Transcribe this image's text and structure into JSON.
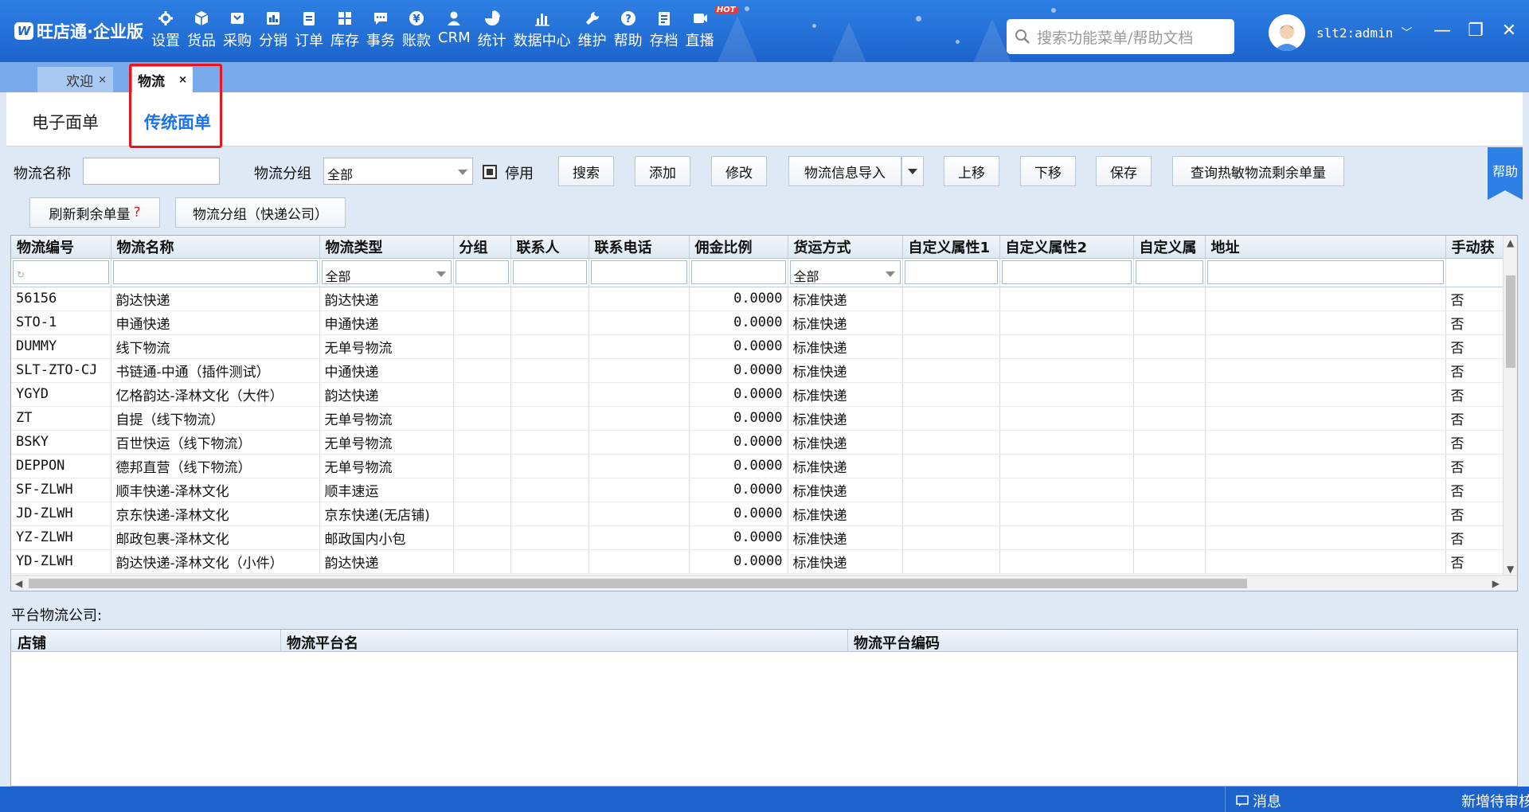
{
  "app": {
    "logo": "旺店通·企业版",
    "logo_mark": "W",
    "nav": [
      {
        "label": "设置",
        "icon": "gear-icon"
      },
      {
        "label": "货品",
        "icon": "cube-icon"
      },
      {
        "label": "采购",
        "icon": "cart-icon"
      },
      {
        "label": "分销",
        "icon": "grid-icon"
      },
      {
        "label": "订单",
        "icon": "clipboard-icon"
      },
      {
        "label": "库存",
        "icon": "blocks-icon"
      },
      {
        "label": "事务",
        "icon": "chat-icon"
      },
      {
        "label": "账款",
        "icon": "yen-icon"
      },
      {
        "label": "CRM",
        "icon": "person-icon"
      },
      {
        "label": "统计",
        "icon": "pie-icon"
      },
      {
        "label": "数据中心",
        "icon": "bar-chart-icon"
      },
      {
        "label": "维护",
        "icon": "wrench-icon"
      },
      {
        "label": "帮助",
        "icon": "question-icon"
      },
      {
        "label": "存档",
        "icon": "archive-icon"
      },
      {
        "label": "直播",
        "icon": "live-icon",
        "badge": "HOT"
      }
    ],
    "search_placeholder": "搜索功能菜单/帮助文档",
    "user": "slt2:admin",
    "window": {
      "minimize": "—",
      "restore": "❐",
      "close": "✕"
    }
  },
  "tabs": [
    {
      "label": "欢迎",
      "close": "×"
    },
    {
      "label": "物流",
      "close": "×",
      "active": true
    }
  ],
  "subtabs": {
    "electronic": "电子面单",
    "traditional": "传统面单"
  },
  "toolbar": {
    "name_label": "物流名称",
    "name_value": "",
    "group_label": "物流分组",
    "group_value": "全部",
    "disabled_label": "停用",
    "search": "搜索",
    "add": "添加",
    "modify": "修改",
    "import": "物流信息导入",
    "move_up": "上移",
    "move_down": "下移",
    "save": "保存",
    "query_thermal": "查询热敏物流剩余单量",
    "refresh_remaining": "刷新剩余单量",
    "refresh_q": "?",
    "group_courier": "物流分组（快递公司）",
    "help": "帮助"
  },
  "grid": {
    "columns": [
      "物流编号",
      "物流名称",
      "物流类型",
      "分组",
      "联系人",
      "联系电话",
      "佣金比例",
      "货运方式",
      "自定义属性1",
      "自定义属性2",
      "自定义属",
      "地址",
      "手动获"
    ],
    "filter": {
      "type": "全部",
      "shipping": "全部"
    },
    "rows": [
      [
        "56156",
        "韵达快递",
        "韵达快递",
        "",
        "",
        "",
        "0.0000",
        "标准快递",
        "",
        "",
        "",
        "",
        "否"
      ],
      [
        "STO-1",
        "申通快递",
        "申通快递",
        "",
        "",
        "",
        "0.0000",
        "标准快递",
        "",
        "",
        "",
        "",
        "否"
      ],
      [
        "DUMMY",
        "线下物流",
        "无单号物流",
        "",
        "",
        "",
        "0.0000",
        "标准快递",
        "",
        "",
        "",
        "",
        "否"
      ],
      [
        "SLT-ZTO-CJ",
        "书链通-中通（插件测试）",
        "中通快递",
        "",
        "",
        "",
        "0.0000",
        "标准快递",
        "",
        "",
        "",
        "",
        "否"
      ],
      [
        "YGYD",
        "亿格韵达-泽林文化（大件）",
        "韵达快递",
        "",
        "",
        "",
        "0.0000",
        "标准快递",
        "",
        "",
        "",
        "",
        "否"
      ],
      [
        "ZT",
        "自提（线下物流）",
        "无单号物流",
        "",
        "",
        "",
        "0.0000",
        "标准快递",
        "",
        "",
        "",
        "",
        "否"
      ],
      [
        "BSKY",
        "百世快运（线下物流）",
        "无单号物流",
        "",
        "",
        "",
        "0.0000",
        "标准快递",
        "",
        "",
        "",
        "",
        "否"
      ],
      [
        "DEPPON",
        "德邦直营（线下物流）",
        "无单号物流",
        "",
        "",
        "",
        "0.0000",
        "标准快递",
        "",
        "",
        "",
        "",
        "否"
      ],
      [
        "SF-ZLWH",
        "顺丰快递-泽林文化",
        "顺丰速运",
        "",
        "",
        "",
        "0.0000",
        "标准快递",
        "",
        "",
        "",
        "",
        "否"
      ],
      [
        "JD-ZLWH",
        "京东快递-泽林文化",
        "京东快递(无店铺)",
        "",
        "",
        "",
        "0.0000",
        "标准快递",
        "",
        "",
        "",
        "",
        "否"
      ],
      [
        "YZ-ZLWH",
        "邮政包裹-泽林文化",
        "邮政国内小包",
        "",
        "",
        "",
        "0.0000",
        "标准快递",
        "",
        "",
        "",
        "",
        "否"
      ],
      [
        "YD-ZLWH",
        "韵达快递-泽林文化（小件）",
        "韵达快递",
        "",
        "",
        "",
        "0.0000",
        "标准快递",
        "",
        "",
        "",
        "",
        "否"
      ]
    ]
  },
  "platform": {
    "label": "平台物流公司:",
    "columns": [
      "店铺",
      "物流平台名",
      "物流平台编码"
    ]
  },
  "statusbar": {
    "message": "消息",
    "new_pending": "新增待审核"
  }
}
